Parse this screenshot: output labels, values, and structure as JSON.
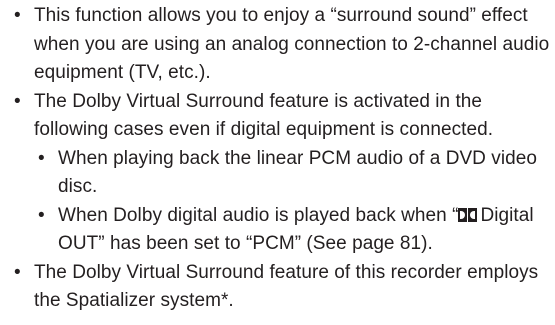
{
  "bullet_char": "•",
  "items": [
    {
      "text": "This function allows you to enjoy a “surround sound” effect when you are using an analog connection to 2-channel audio equipment (TV, etc.)."
    },
    {
      "text": "The Dolby Virtual Surround feature is activated in the following cases even if digital equipment is connected.",
      "subitems": [
        {
          "text": "When playing back the linear PCM audio of a DVD video disc."
        },
        {
          "text_before": "When Dolby digital audio is played back when “",
          "logo_icon": "dolby-double-d-icon",
          "text_after": "Digital OUT” has been set to “PCM” (See page 81)."
        }
      ]
    },
    {
      "text": "The Dolby Virtual Surround feature of this recorder employs the Spatializer system*."
    }
  ]
}
